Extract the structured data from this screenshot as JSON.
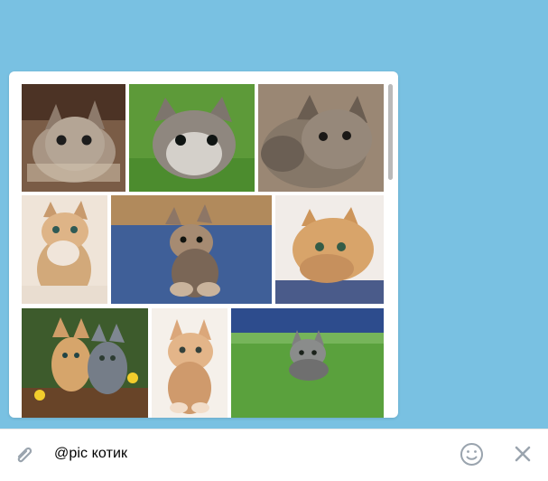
{
  "background_color": "#79c1e2",
  "results": {
    "items": [
      {
        "icon": "cat-photo-icon",
        "palette": [
          "#7a5c46",
          "#d6c6b0",
          "#918070"
        ]
      },
      {
        "icon": "cat-photo-icon",
        "palette": [
          "#5d9a39",
          "#b8b4ad",
          "#766e67"
        ]
      },
      {
        "icon": "cat-photo-icon",
        "palette": [
          "#9a8774",
          "#857768",
          "#5d544a"
        ]
      },
      {
        "icon": "cat-photo-icon",
        "palette": [
          "#efe4d8",
          "#d2a97a",
          "#b9875a"
        ]
      },
      {
        "icon": "cat-photo-icon",
        "palette": [
          "#3f5f98",
          "#a68b72",
          "#7a6656"
        ]
      },
      {
        "icon": "cat-photo-icon",
        "palette": [
          "#f1ece8",
          "#d8a46a",
          "#c6905d"
        ]
      },
      {
        "icon": "cat-photo-icon",
        "palette": [
          "#3d5b2c",
          "#d6a56b",
          "#757d88"
        ]
      },
      {
        "icon": "cat-photo-icon",
        "palette": [
          "#f5f0ea",
          "#e3b589",
          "#cf9a6c"
        ]
      },
      {
        "icon": "cat-photo-icon",
        "palette": [
          "#5aa13d",
          "#8a8c8b",
          "#6f6f6f"
        ]
      }
    ]
  },
  "composer": {
    "query": "@pic котик",
    "attach_icon": "paperclip-icon",
    "emoji_icon": "smile-icon",
    "close_icon": "close-icon"
  }
}
